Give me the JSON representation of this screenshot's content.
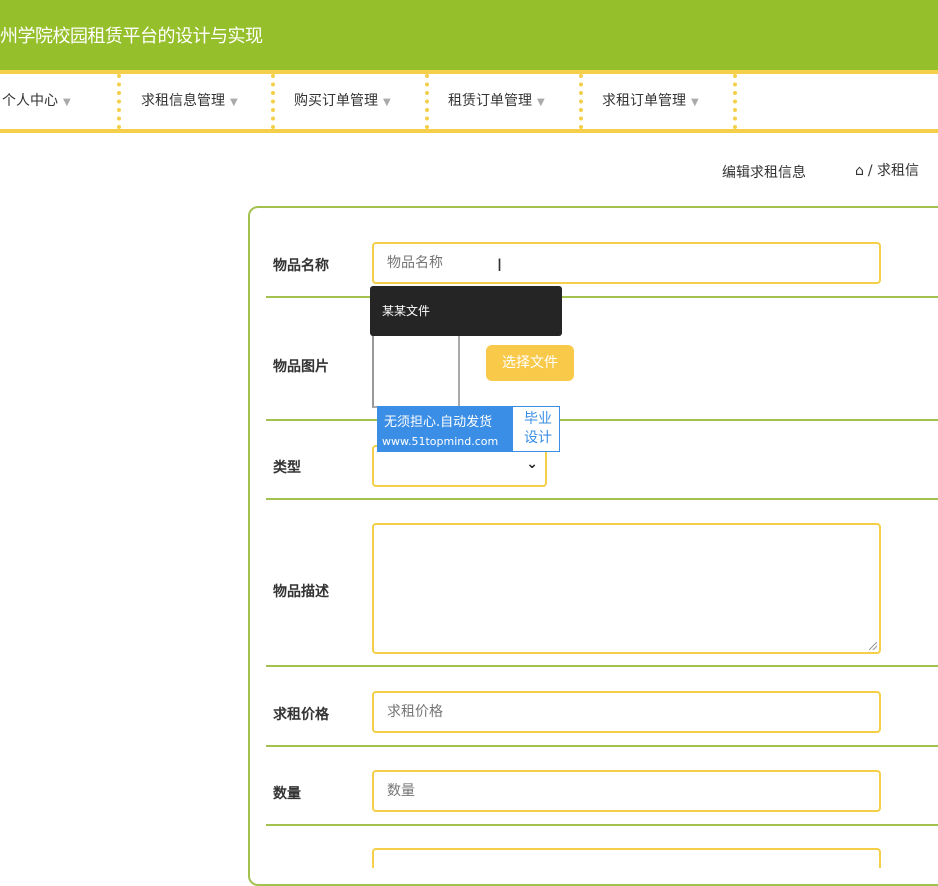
{
  "header": {
    "title": "州学院校园租赁平台的设计与实现"
  },
  "nav": {
    "items": [
      {
        "label": "个人中心"
      },
      {
        "label": "求租信息管理"
      },
      {
        "label": "购买订单管理"
      },
      {
        "label": "租赁订单管理"
      },
      {
        "label": "求租订单管理"
      }
    ]
  },
  "breadcrumb": {
    "current": "编辑求租信息",
    "path": "/ 求租信"
  },
  "form": {
    "item_name": {
      "label": "物品名称",
      "placeholder": "物品名称",
      "value": ""
    },
    "item_image": {
      "label": "物品图片",
      "button": "选择文件",
      "tooltip": "某某文件"
    },
    "type": {
      "label": "类型",
      "value": ""
    },
    "description": {
      "label": "物品描述",
      "value": ""
    },
    "price": {
      "label": "求租价格",
      "placeholder": "求租价格",
      "value": ""
    },
    "quantity": {
      "label": "数量",
      "placeholder": "数量",
      "value": ""
    }
  },
  "watermark": {
    "line1": "无须担心.自动发货",
    "line2": "www.51topmind.com",
    "side_top": "毕业",
    "side_bottom": "设计"
  },
  "colors": {
    "header": "#96bf2c",
    "accent": "#f6cf4a",
    "line": "#a3c14f",
    "button": "#f9c94a"
  }
}
